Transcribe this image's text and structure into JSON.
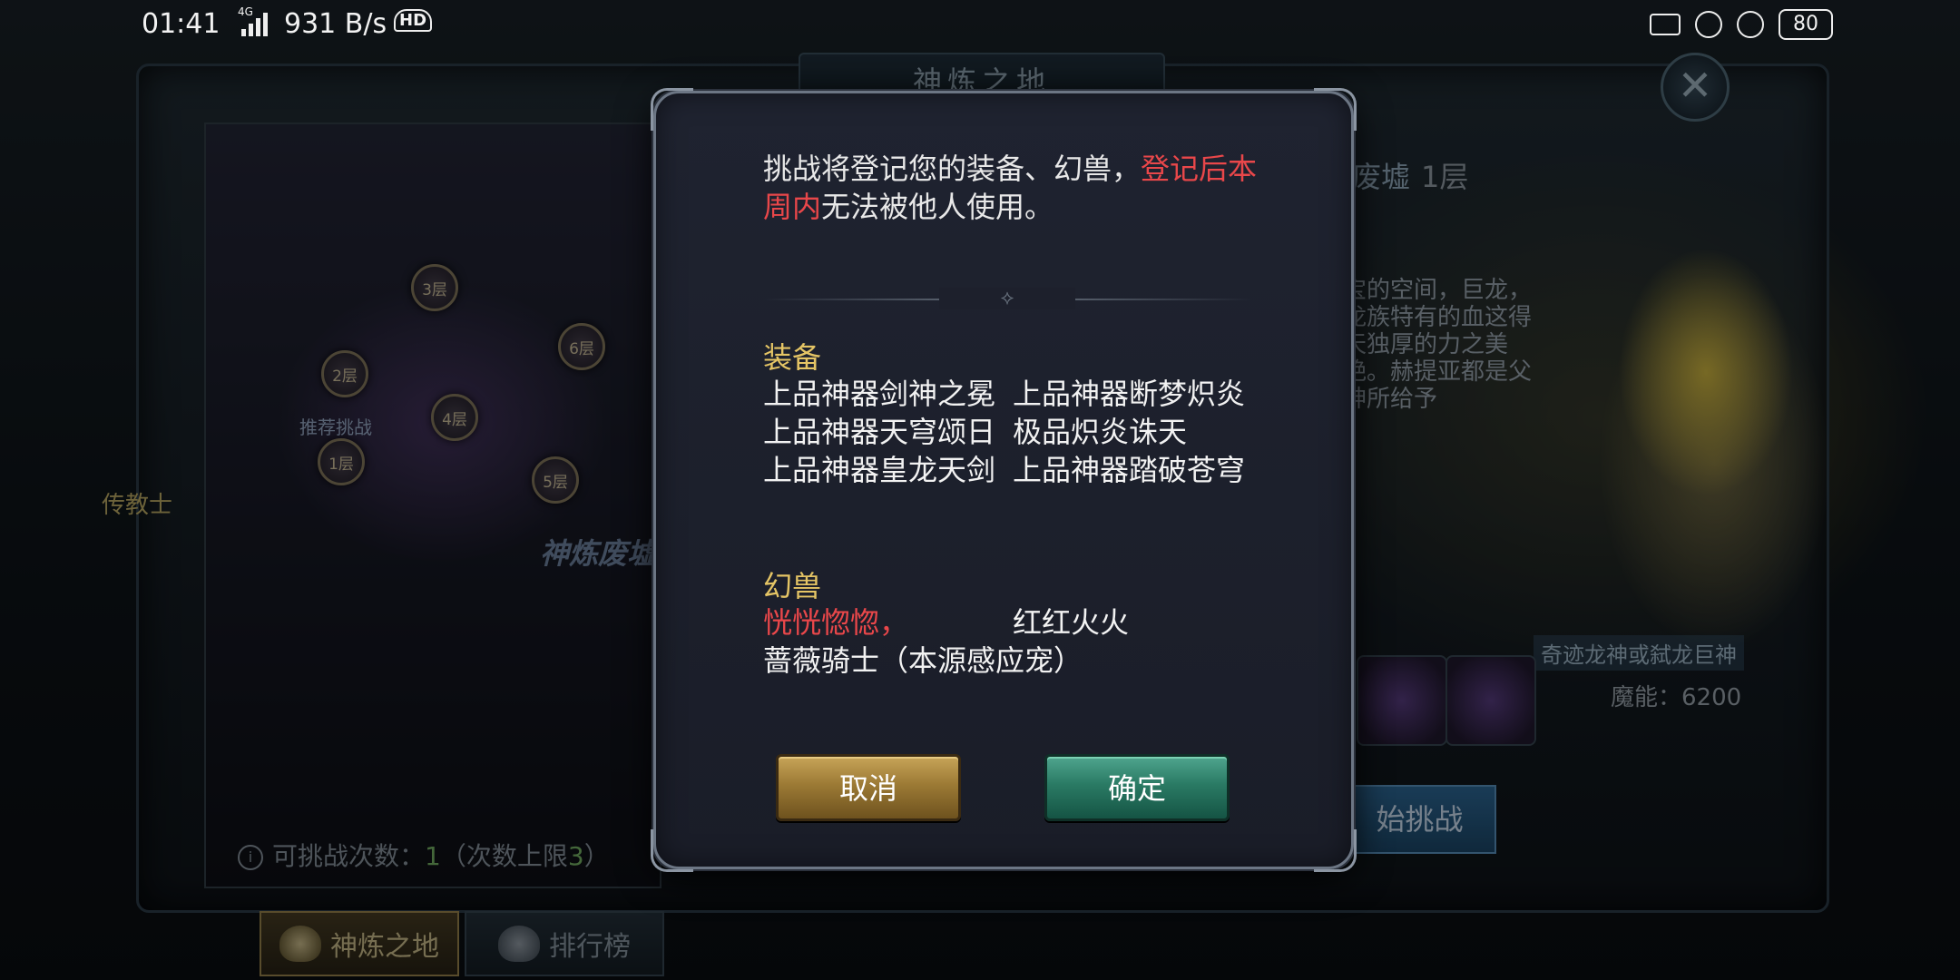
{
  "status_bar": {
    "time": "01:41",
    "network_type": "4G",
    "speed": "931 B/s",
    "hd": "HD",
    "battery": "80"
  },
  "background": {
    "window_title": "神炼之地",
    "map_nodes": [
      "1层",
      "2层",
      "3层",
      "4层",
      "5层",
      "6层"
    ],
    "recommend_tag": "推荐挑战",
    "map_area_name": "神炼废墟",
    "npc_label": "传教士",
    "level_name": "废墟",
    "level_floor": "1层",
    "lore_text": "宝的空间，巨龙，龙族特有的血这得天独厚的力之美艳。赫提亚都是父神所给予",
    "boss_name": "奇迹龙神或弑龙巨神",
    "mana": "魔能：6200",
    "start_button": "始挑战",
    "challenge_info_prefix": "可挑战次数：",
    "challenge_count": "1",
    "challenge_limit_text": "（次数上限",
    "challenge_limit": "3",
    "challenge_suffix": "）",
    "tabs": [
      {
        "label": "神炼之地",
        "active": true
      },
      {
        "label": "排行榜",
        "active": false
      }
    ]
  },
  "dialog": {
    "message_part1": "挑战将登记您的装备、幻兽，",
    "message_red": "登记后本周内",
    "message_part2": "无法被他人使用。",
    "divider_ornament": "⟡",
    "equipment_title": "装备",
    "equipment": [
      [
        "上品神器剑神之冕",
        "上品神器断梦炽炎"
      ],
      [
        "上品神器天穹颂日",
        "极品炽炎诛天"
      ],
      [
        "上品神器皇龙天剑",
        "上品神器踏破苍穹"
      ]
    ],
    "beast_title": "幻兽",
    "beasts_row1_red": "恍恍惚惚，",
    "beasts_row1_b": "红红火火",
    "beasts_row2": "蔷薇骑士（本源感应宠）",
    "cancel_label": "取消",
    "confirm_label": "确定"
  },
  "colors": {
    "highlight_red": "#e9474a",
    "section_gold": "#e5c565",
    "cancel_gold": "#c7a458",
    "confirm_green": "#2a7a64"
  }
}
